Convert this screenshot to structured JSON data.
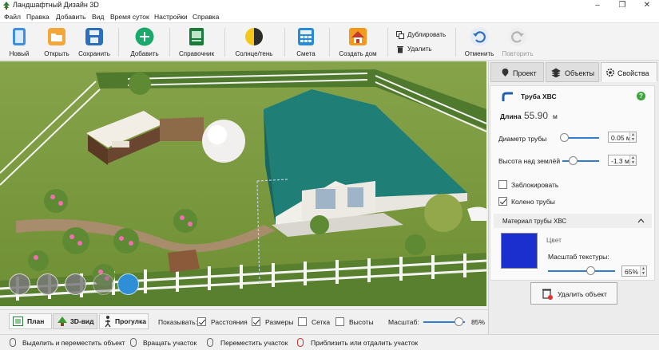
{
  "window": {
    "title": "Ландшафтный Дизайн 3D",
    "controls": [
      "minimize-icon",
      "restore-icon",
      "close-icon"
    ]
  },
  "menu": [
    "Файл",
    "Правка",
    "Добавить",
    "Вид",
    "Время суток",
    "Настройки",
    "Справка"
  ],
  "toolbar": {
    "new": "Новый",
    "open": "Открыть",
    "save": "Сохранить",
    "add": "Добавить",
    "reference": "Справочник",
    "sun_shadow": "Солнце/тень",
    "estimate": "Смета",
    "create_house": "Создать дом",
    "duplicate": "Дублировать",
    "delete": "Удалить",
    "undo": "Отменить",
    "redo": "Повторить"
  },
  "view_tabs": {
    "plan": "План",
    "view3d": "3D-вид",
    "walk": "Прогулка",
    "active": "3D-вид"
  },
  "show_options": {
    "label": "Показывать:",
    "distances": {
      "label": "Расстояния",
      "checked": true
    },
    "sizes": {
      "label": "Размеры",
      "checked": true
    },
    "grid": {
      "label": "Сетка",
      "checked": false
    },
    "heights": {
      "label": "Высоты",
      "checked": false
    }
  },
  "zoom": {
    "label": "Масштаб:",
    "value": "85%",
    "level_percent": 85
  },
  "status_bar": {
    "select_move": "Выделить и переместить объект",
    "rotate_area": "Вращать участок",
    "move_area": "Переместить участок",
    "zoom_area": "Приблизить или отдалить участок"
  },
  "panel_tabs": {
    "project": "Проект",
    "objects": "Объекты",
    "properties": "Свойства",
    "active": "Свойства"
  },
  "properties": {
    "object_title": "Труба ХВС",
    "help": "?",
    "length_label": "Длина",
    "length_value": "55.90",
    "length_unit": "м",
    "diameter_label": "Диаметр трубы",
    "diameter_value": "0.05 м",
    "height_label": "Высота над землёй",
    "height_value": "-1.3 м",
    "lock_label": "Заблокировать",
    "lock_checked": false,
    "elbow_label": "Колено трубы",
    "elbow_checked": true,
    "material_header": "Материал трубы ХВС",
    "color_label": "Цвет",
    "color_hex": "#1b2fcf",
    "texture_scale_label": "Масштаб текстуры:",
    "texture_scale_value": "65%",
    "delete_button": "Удалить объект"
  },
  "viewport_tools": [
    "garden-tool-icon",
    "hand-icon",
    "ruler-icon",
    "text-icon",
    "layers-icon"
  ],
  "colors": {
    "accent": "#2e7fd0",
    "grass": "#7b9a3c",
    "roof": "#1f7f77"
  }
}
